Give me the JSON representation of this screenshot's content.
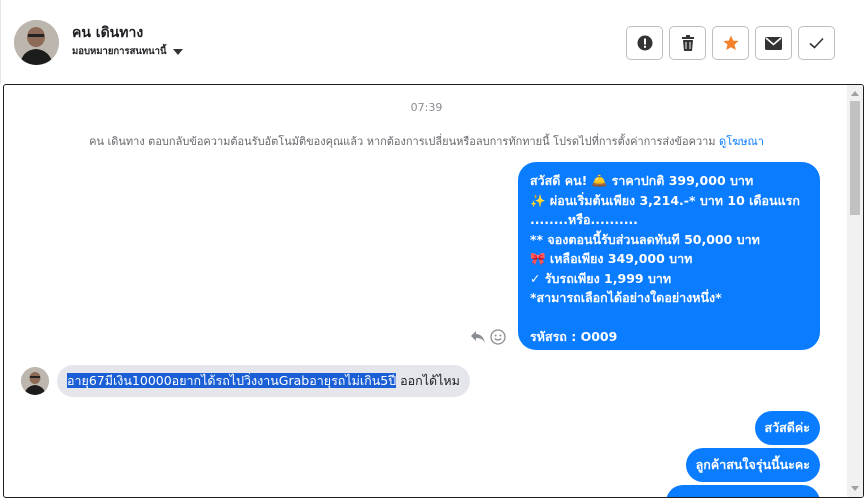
{
  "header": {
    "contact_name": "คน เดินทาง",
    "assign_label": "มอบหมายการสนทนานี้",
    "actions": [
      {
        "name": "report",
        "icon": "alert-circle-icon"
      },
      {
        "name": "delete",
        "icon": "trash-icon"
      },
      {
        "name": "star",
        "icon": "star-icon",
        "color": "#f5822a"
      },
      {
        "name": "mark-unread",
        "icon": "envelope-icon"
      },
      {
        "name": "mark-done",
        "icon": "check-icon"
      }
    ]
  },
  "chat": {
    "timestamp": "07:39",
    "system_note": "คน เดินทาง ตอบกลับข้อความต้อนรับอัตโนมัติของคุณแล้ว หากต้องการเปลี่ยนหรือลบการทักทายนี้ โปรดไปที่การตั้งค่าการส่งข้อความ",
    "system_link": "ดูโฆษณา",
    "outgoing_main": {
      "lines": [
        "สวัสดี คน! 🛎️ ราคาปกติ 399,000 บาท",
        "✨  ผ่อนเริ่มต้นเพียง 3,214.-* บาท 10 เดือนแรก",
        "........หรือ..........",
        "** จองตอนนี้รับส่วนลดทันที 50,000 บาท",
        "🎀  เหลือเพียง 349,000 บาท",
        "✓ รับรถเพียง 1,999 บาท",
        "*สามารถเลือกได้อย่างใดอย่างหนึ่ง*",
        "",
        "รหัสรถ : O009"
      ]
    },
    "incoming": {
      "selected_text": "อายุ67มีเงิน10000อยากได้รถไปวิ่งงานGrabอายุรถไม่เกิน5ปี",
      "rest_text": " ออกได้ไหม"
    },
    "outgoing_small": [
      "สวัสดีค่ะ",
      "ลูกค้าสนใจรุ่นนี้นะคะ"
    ],
    "accent_color": "#0a7cff"
  }
}
